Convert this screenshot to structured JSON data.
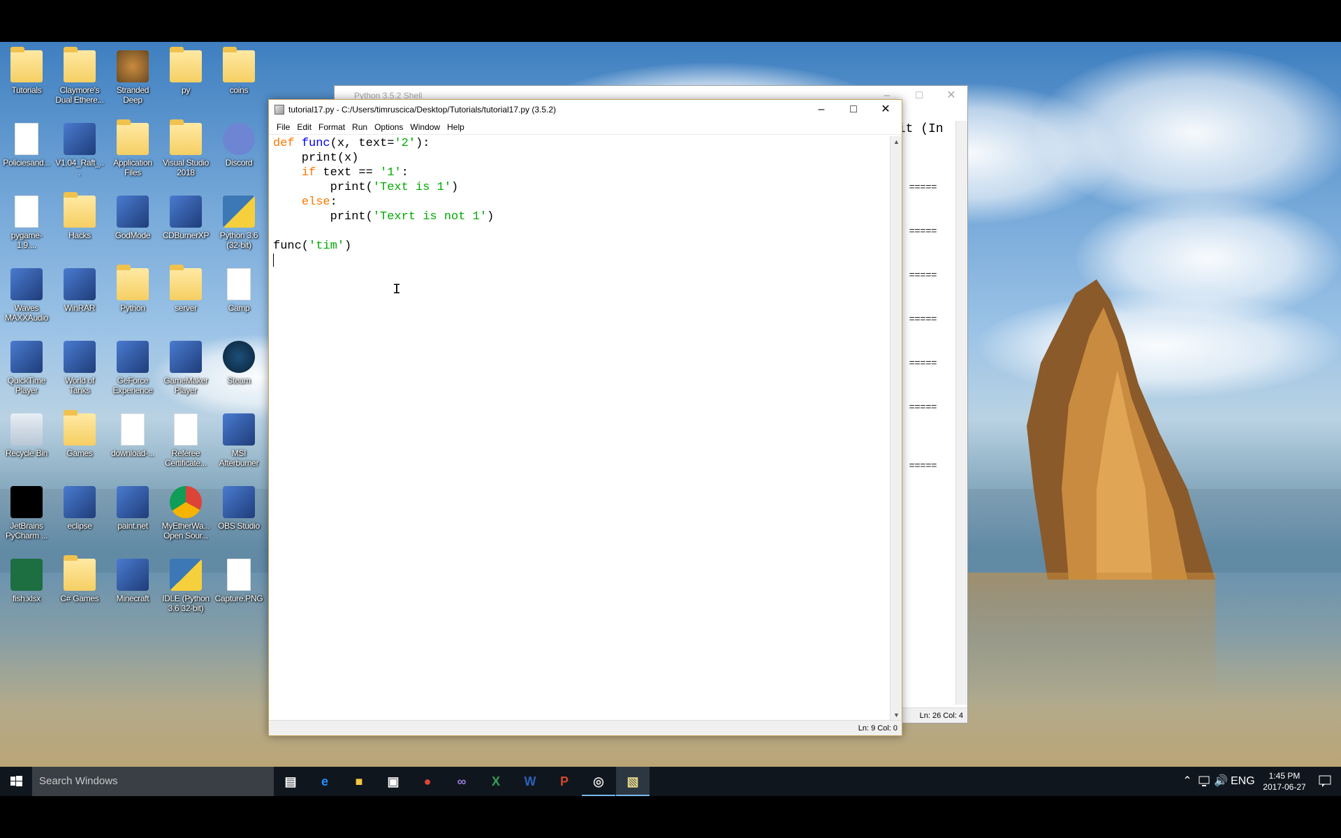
{
  "desktop": {
    "icons": [
      {
        "label": "Tutorials",
        "kind": "folder"
      },
      {
        "label": "Claymore's Dual Ethere...",
        "kind": "folder"
      },
      {
        "label": "Stranded Deep",
        "kind": "game"
      },
      {
        "label": "py",
        "kind": "folder"
      },
      {
        "label": "coins",
        "kind": "folder"
      },
      {
        "label": "Policiesand...",
        "kind": "pdf"
      },
      {
        "label": "V1.04_Raft_...",
        "kind": "app"
      },
      {
        "label": "Application Files",
        "kind": "folder"
      },
      {
        "label": "Visual Studio 2018",
        "kind": "folder"
      },
      {
        "label": "Discord",
        "kind": "discord"
      },
      {
        "label": "pygame-1.9....",
        "kind": "file"
      },
      {
        "label": "Hacks",
        "kind": "folder"
      },
      {
        "label": "GodMode",
        "kind": "app"
      },
      {
        "label": "CDBurnerXP",
        "kind": "app"
      },
      {
        "label": "Python 3.6 (32-bit)",
        "kind": "python"
      },
      {
        "label": "Waves MAXXAudio",
        "kind": "app"
      },
      {
        "label": "WinRAR",
        "kind": "app"
      },
      {
        "label": "Python",
        "kind": "folder"
      },
      {
        "label": "server",
        "kind": "folder"
      },
      {
        "label": "Camp",
        "kind": "pdf"
      },
      {
        "label": "QuickTime Player",
        "kind": "app"
      },
      {
        "label": "World of Tanks",
        "kind": "app"
      },
      {
        "label": "GeForce Experience",
        "kind": "app"
      },
      {
        "label": "GameMaker Player",
        "kind": "app"
      },
      {
        "label": "Steam",
        "kind": "steam"
      },
      {
        "label": "Recycle Bin",
        "kind": "bin"
      },
      {
        "label": "Games",
        "kind": "folder"
      },
      {
        "label": "download-...",
        "kind": "file"
      },
      {
        "label": "Referee Certificate...",
        "kind": "file"
      },
      {
        "label": "MSI Afterburner",
        "kind": "app"
      },
      {
        "label": "JetBrains PyCharm ...",
        "kind": "pycharm"
      },
      {
        "label": "eclipse",
        "kind": "app"
      },
      {
        "label": "paint.net",
        "kind": "app"
      },
      {
        "label": "MyEtherWa... Open Sour...",
        "kind": "chrome"
      },
      {
        "label": "OBS Studio",
        "kind": "app"
      },
      {
        "label": "fish.xlsx",
        "kind": "excel"
      },
      {
        "label": "C# Games",
        "kind": "folder"
      },
      {
        "label": "Minecraft",
        "kind": "app"
      },
      {
        "label": "IDLE (Python 3.6 32-bit)",
        "kind": "python"
      },
      {
        "label": "Capture.PNG",
        "kind": "file"
      }
    ]
  },
  "shell": {
    "title": "Python 3.5.2 Shell",
    "visible_text": "bit (In",
    "separator": "=====",
    "status": "Ln: 26   Col: 4"
  },
  "editor": {
    "title": "tutorial17.py - C:/Users/timruscica/Desktop/Tutorials/tutorial17.py (3.5.2)",
    "menu": [
      "File",
      "Edit",
      "Format",
      "Run",
      "Options",
      "Window",
      "Help"
    ],
    "status": "Ln: 9   Col: 0",
    "code": [
      [
        {
          "t": "def",
          "c": "kw"
        },
        {
          "t": " "
        },
        {
          "t": "func",
          "c": "fn"
        },
        {
          "t": "(x, text="
        },
        {
          "t": "'2'",
          "c": "str"
        },
        {
          "t": "):"
        }
      ],
      [
        {
          "t": "    print(x)"
        }
      ],
      [
        {
          "t": "    "
        },
        {
          "t": "if",
          "c": "kw"
        },
        {
          "t": " text == "
        },
        {
          "t": "'1'",
          "c": "str"
        },
        {
          "t": ":"
        }
      ],
      [
        {
          "t": "        print("
        },
        {
          "t": "'Text is 1'",
          "c": "str"
        },
        {
          "t": ")"
        }
      ],
      [
        {
          "t": "    "
        },
        {
          "t": "else",
          "c": "kw"
        },
        {
          "t": ":"
        }
      ],
      [
        {
          "t": "        print("
        },
        {
          "t": "'Texrt is not 1'",
          "c": "str"
        },
        {
          "t": ")"
        }
      ],
      [
        {
          "t": ""
        }
      ],
      [
        {
          "t": "func("
        },
        {
          "t": "'tim'",
          "c": "str"
        },
        {
          "t": ")"
        }
      ],
      [
        {
          "t": ""
        }
      ]
    ]
  },
  "taskbar": {
    "search_placeholder": "Search Windows",
    "apps": [
      "task-view",
      "edge",
      "file-explorer",
      "store",
      "chrome",
      "visual-studio",
      "excel",
      "word",
      "powerpoint",
      "obs",
      "idle"
    ],
    "tray": {
      "language": "ENG",
      "time": "1:45 PM",
      "date": "2017-06-27"
    }
  },
  "colors": {
    "keyword": "#ff7700",
    "string": "#00aa00",
    "builtin": "#0000ff",
    "taskbar": "#10161e"
  }
}
